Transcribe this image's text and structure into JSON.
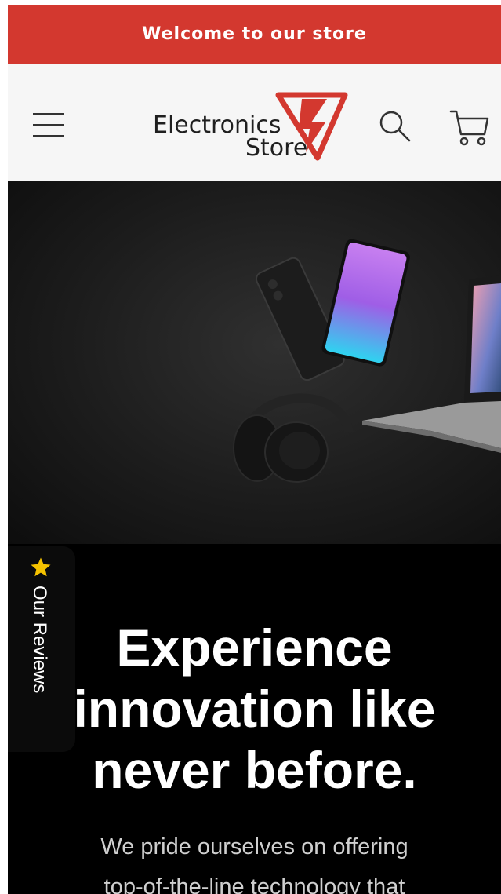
{
  "announcement": {
    "text": "Welcome to our store"
  },
  "header": {
    "logo": {
      "line1": "Electronics",
      "line2": "Store"
    },
    "icons": {
      "menu": "hamburger-menu-icon",
      "search": "search-icon",
      "cart": "cart-icon"
    }
  },
  "reviews_tab": {
    "label": "Our Reviews",
    "icon": "star-icon"
  },
  "hero": {
    "headline_lines": [
      "Experience",
      "innovation like",
      "never before."
    ],
    "subtext_lines": [
      "We pride ourselves on offering",
      "top-of-the-line technology that"
    ]
  },
  "colors": {
    "accent": "#d3382f",
    "header_bg": "#f6f6f6",
    "hero_bg": "#000000",
    "star": "#f5c200"
  }
}
